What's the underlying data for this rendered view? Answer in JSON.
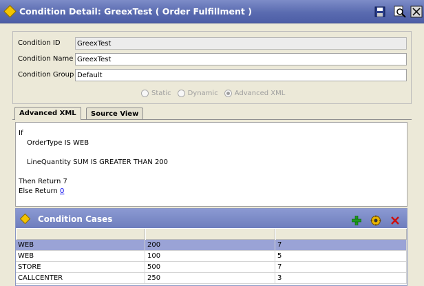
{
  "window": {
    "title": "Condition Detail: GreexTest ( Order Fulfillment )"
  },
  "form": {
    "condition_id_label": "Condition ID",
    "condition_id_value": "GreexTest",
    "condition_name_label": "Condition Name",
    "condition_name_value": "GreexTest",
    "condition_group_label": "Condition Group",
    "condition_group_value": "Default",
    "radio_static": "Static",
    "radio_dynamic": "Dynamic",
    "radio_advanced": "Advanced XML",
    "selected_radio": "Advanced XML"
  },
  "tabs": [
    {
      "label": "Advanced XML",
      "active": true
    },
    {
      "label": "Source View",
      "active": false
    }
  ],
  "xml": {
    "line1": "If",
    "line2": "OrderType IS  WEB",
    "line3": "LineQuantity SUM IS  GREATER THAN  200",
    "line4": "Then Return 7",
    "line5_prefix": "Else  Return ",
    "line5_link": "0"
  },
  "cases": {
    "title": "Condition Cases",
    "rows": [
      [
        "WEB",
        "200",
        "7"
      ],
      [
        "WEB",
        "100",
        "5"
      ],
      [
        "STORE",
        "500",
        "7"
      ],
      [
        "CALLCENTER",
        "250",
        "3"
      ]
    ],
    "selected_row": 0
  },
  "colors": {
    "titlebar": "#5a6bb0",
    "cases_header": "#7a89c6",
    "selection": "#9aa3d6",
    "diamond": "#f4c400",
    "add_green": "#1e9a1e",
    "delete_red": "#cc1111"
  },
  "icons": [
    "save-icon",
    "find-icon",
    "close-icon",
    "add-icon",
    "details-icon",
    "delete-icon"
  ]
}
